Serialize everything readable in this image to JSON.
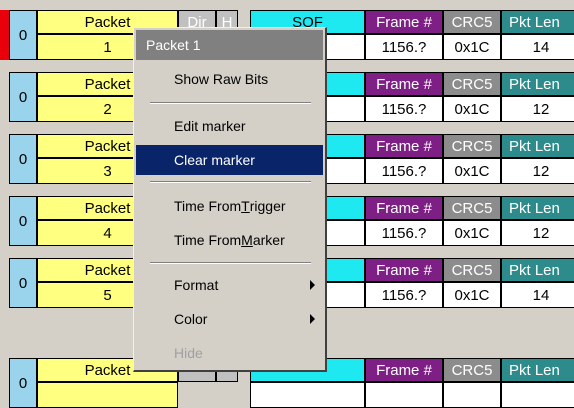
{
  "rows": [
    {
      "idle": "0",
      "packet_label": "Packet",
      "packet_num": "1",
      "dir": "Dir",
      "hs": "H",
      "sof": "SOF",
      "frame_header": "Frame #",
      "crc_header": "CRC5",
      "len_header": "Pkt Len",
      "frame": "1156.?",
      "crc": "0x1C",
      "len": "14",
      "marked": true
    },
    {
      "idle": "0",
      "packet_label": "Packet",
      "packet_num": "2",
      "dir": "",
      "hs": "",
      "sof": "",
      "frame_header": "Frame #",
      "crc_header": "CRC5",
      "len_header": "Pkt Len",
      "frame": "1156.?",
      "crc": "0x1C",
      "len": "12",
      "marked": false
    },
    {
      "idle": "0",
      "packet_label": "Packet",
      "packet_num": "3",
      "dir": "",
      "hs": "",
      "sof": "",
      "frame_header": "Frame #",
      "crc_header": "CRC5",
      "len_header": "Pkt Len",
      "frame": "1156.?",
      "crc": "0x1C",
      "len": "12",
      "marked": false
    },
    {
      "idle": "0",
      "packet_label": "Packet",
      "packet_num": "4",
      "dir": "",
      "hs": "",
      "sof": "",
      "frame_header": "Frame #",
      "crc_header": "CRC5",
      "len_header": "Pkt Len",
      "frame": "1156.?",
      "crc": "0x1C",
      "len": "12",
      "marked": false
    },
    {
      "idle": "0",
      "packet_label": "Packet",
      "packet_num": "5",
      "dir": "",
      "hs": "",
      "sof": "",
      "frame_header": "Frame #",
      "crc_header": "CRC5",
      "len_header": "Pkt Len",
      "frame": "1156.?",
      "crc": "0x1C",
      "len": "14",
      "marked": false
    },
    {
      "idle": "0",
      "packet_label": "Packet",
      "packet_num": "",
      "dir": "",
      "hs": "",
      "sof": "",
      "frame_header": "Frame #",
      "crc_header": "CRC5",
      "len_header": "Pkt Len",
      "frame": "",
      "crc": "",
      "len": "",
      "marked": false
    }
  ],
  "context_menu": {
    "title": "Packet 1",
    "items": [
      {
        "label": "Show Raw Bits"
      },
      {
        "label": "Edit marker"
      },
      {
        "label": "Clear marker",
        "highlighted": true
      },
      {
        "label_pre": "Time From ",
        "label_accel": "T",
        "label_post": "rigger"
      },
      {
        "label_pre": "Time From ",
        "label_accel": "M",
        "label_post": "arker"
      },
      {
        "label": "Format",
        "submenu": true
      },
      {
        "label": "Color",
        "submenu": true
      },
      {
        "label": "Hide",
        "disabled": true
      }
    ]
  },
  "colors": {
    "marker": "#e8000b",
    "idle": "#9ad3ec",
    "packet": "#ffff80",
    "sof": "#1ee8f0",
    "frame": "#7e1f86",
    "crc": "#8c8c8c",
    "pkt_len": "#2e8b8b",
    "menu_highlight": "#0a246a"
  }
}
